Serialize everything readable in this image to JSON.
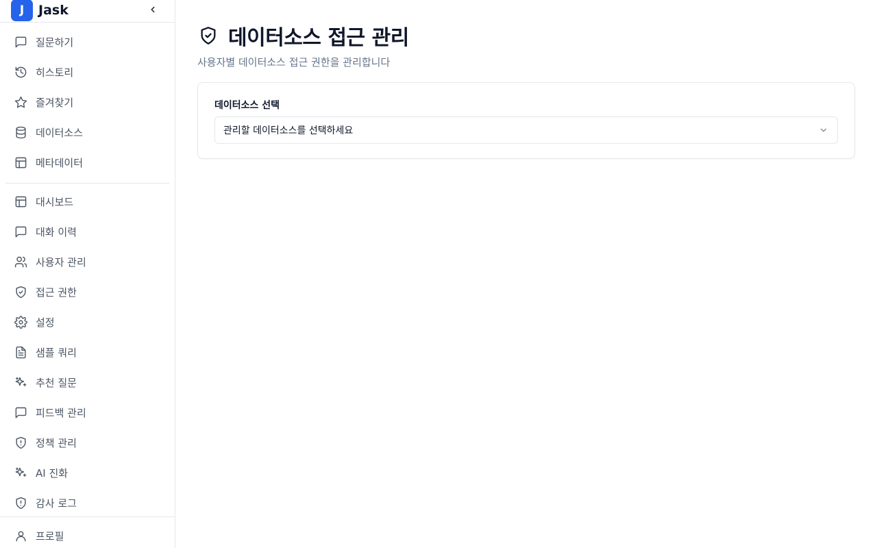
{
  "brand": {
    "logo_letter": "J",
    "name": "Jask"
  },
  "sidebar": {
    "primary": [
      {
        "label": "질문하기",
        "icon": "message-square-icon"
      },
      {
        "label": "히스토리",
        "icon": "history-icon"
      },
      {
        "label": "즐겨찾기",
        "icon": "star-icon"
      },
      {
        "label": "데이터소스",
        "icon": "database-icon"
      },
      {
        "label": "메타데이터",
        "icon": "layout-icon"
      }
    ],
    "admin": [
      {
        "label": "대시보드",
        "icon": "layout-icon"
      },
      {
        "label": "대화 이력",
        "icon": "message-square-icon"
      },
      {
        "label": "사용자 관리",
        "icon": "users-icon"
      },
      {
        "label": "접근 권한",
        "icon": "shield-check-icon"
      },
      {
        "label": "설정",
        "icon": "gear-icon"
      },
      {
        "label": "샘플 쿼리",
        "icon": "file-text-icon"
      },
      {
        "label": "추천 질문",
        "icon": "sparkles-icon"
      },
      {
        "label": "피드백 관리",
        "icon": "message-square-icon"
      },
      {
        "label": "정책 관리",
        "icon": "shield-alert-icon"
      },
      {
        "label": "AI 진화",
        "icon": "sparkles-icon"
      },
      {
        "label": "감사 로그",
        "icon": "shield-alert-icon"
      }
    ],
    "bottom": [
      {
        "label": "프로필",
        "icon": "user-icon"
      }
    ]
  },
  "page": {
    "title": "데이터소스 접근 관리",
    "subtitle": "사용자별 데이터소스 접근 권한을 관리합니다",
    "title_icon": "shield-check-icon"
  },
  "card": {
    "field_label": "데이터소스 선택",
    "select_placeholder": "관리할 데이터소스를 선택하세요"
  },
  "colors": {
    "accent": "#2563eb",
    "text": "#0f172a",
    "muted": "#64748b",
    "border": "#e5e7eb"
  }
}
